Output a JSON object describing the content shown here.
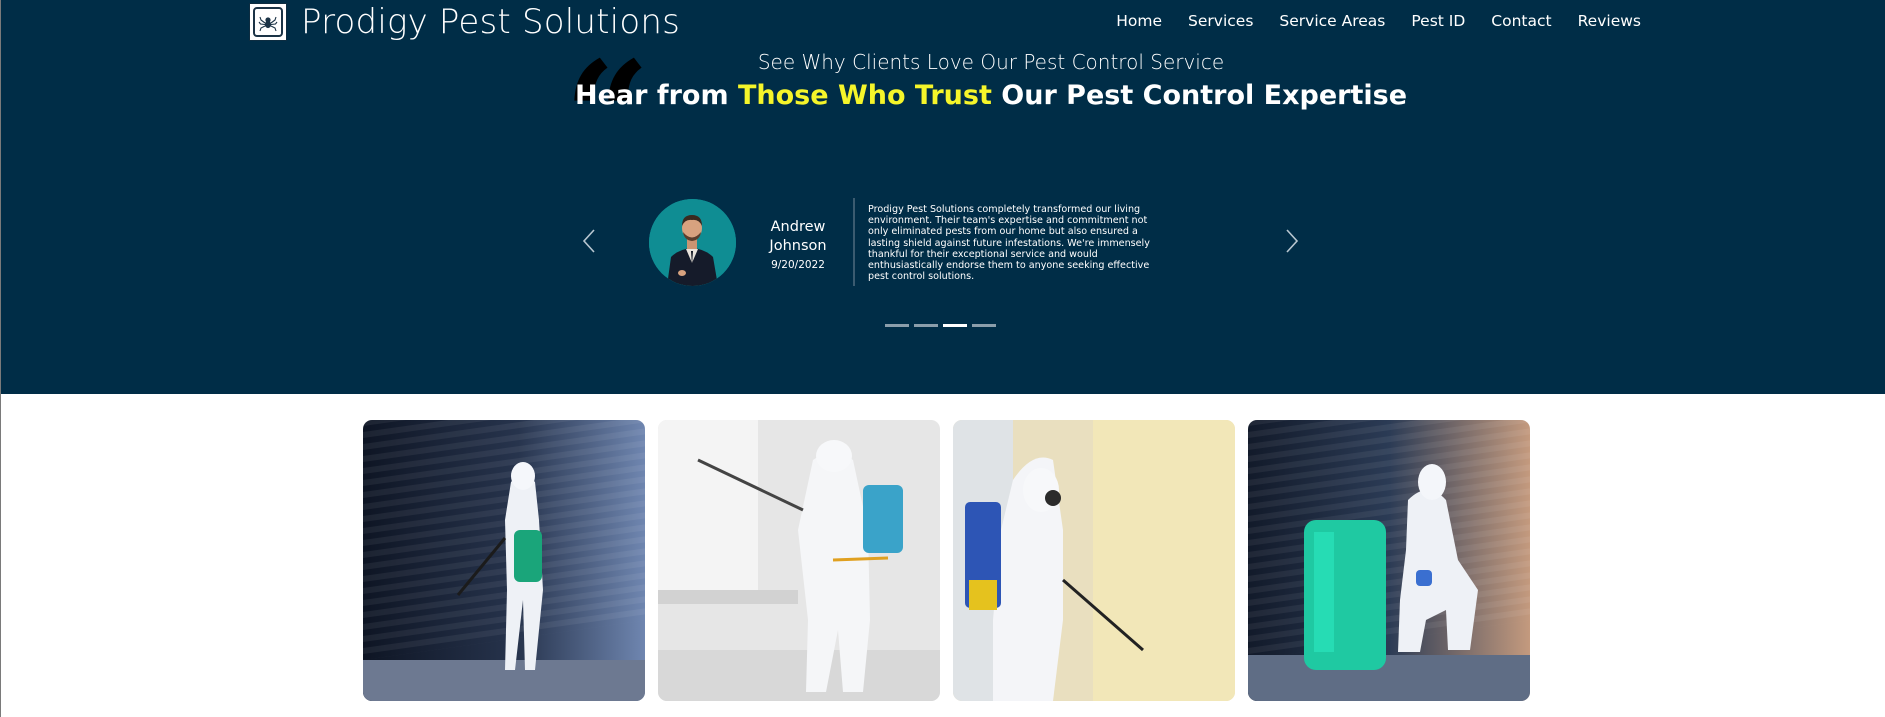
{
  "header": {
    "brand_name": "Prodigy Pest Solutions",
    "logo_icon": "spider-badge-icon",
    "nav": [
      "Home",
      "Services",
      "Service Areas",
      "Pest ID",
      "Contact",
      "Reviews"
    ]
  },
  "testimonials": {
    "subtitle": "See Why Clients Love Our Pest Control Service",
    "headline_start": "Hear from ",
    "headline_highlight": "Those Who Trust",
    "headline_end": " Our Pest Control Expertise",
    "quote_icon": "quote-icon",
    "prev_icon": "chevron-left-icon",
    "next_icon": "chevron-right-icon",
    "current": {
      "name": "Andrew Johnson",
      "date": "9/20/2022",
      "text": "Prodigy Pest Solutions completely transformed our living environment. Their team's expertise and commitment not only eliminated pests from our home but also ensured a lasting shield against future infestations. We're immensely thankful for their exceptional service and would enthusiastically endorse them to anyone seeking effective pest control solutions."
    },
    "dot_count": 4,
    "active_dot": 3
  },
  "colors": {
    "hero_bg": "#002d47",
    "highlight": "#f5f52a",
    "avatar_bg": "#0f8d93"
  },
  "gallery": [
    {
      "alt_icon": "technician-spraying-photo"
    },
    {
      "alt_icon": "technician-window-photo"
    },
    {
      "alt_icon": "technician-hallway-photo"
    },
    {
      "alt_icon": "technician-crouching-photo"
    }
  ]
}
